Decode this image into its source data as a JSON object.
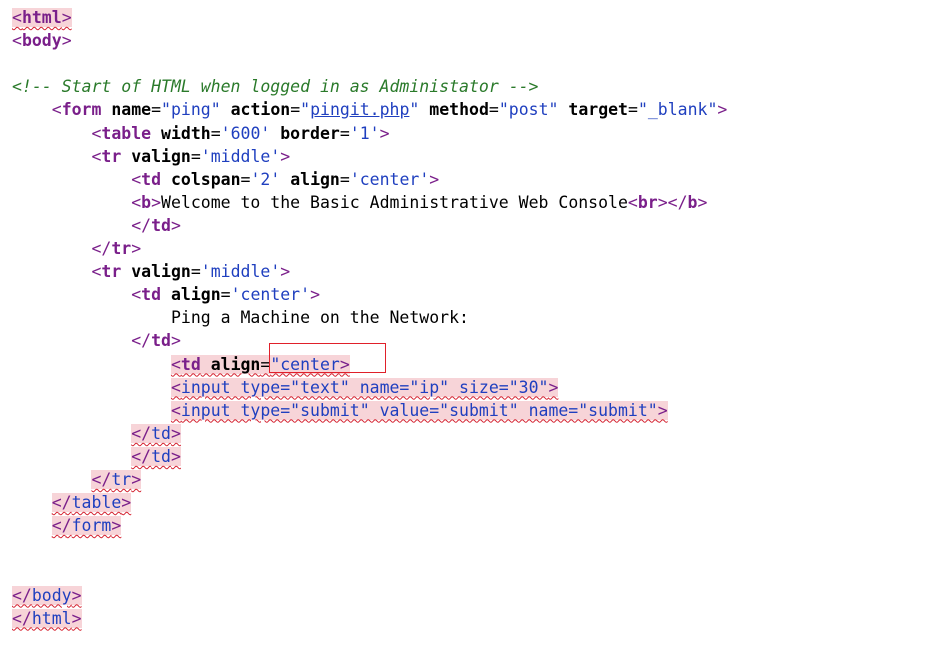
{
  "editor": {
    "lines": [
      {
        "indent": "",
        "parts": [
          {
            "cls": "br",
            "t": "<"
          },
          {
            "cls": "tg",
            "t": "html"
          },
          {
            "cls": "br",
            "t": ">"
          }
        ],
        "error": true
      },
      {
        "indent": "",
        "parts": [
          {
            "cls": "br",
            "t": "<"
          },
          {
            "cls": "tg",
            "t": "body"
          },
          {
            "cls": "br",
            "t": ">"
          }
        ],
        "error": false
      },
      {
        "indent": "",
        "parts": [],
        "error": false
      },
      {
        "indent": "",
        "parts": [
          {
            "cls": "cm",
            "t": "<!-- Start of HTML when logged in as Administator -->"
          }
        ],
        "error": false
      },
      {
        "indent": "    ",
        "parts": [
          {
            "cls": "br",
            "t": "<"
          },
          {
            "cls": "tg",
            "t": "form"
          },
          {
            "cls": "at",
            "t": " name"
          },
          {
            "cls": "tx",
            "t": "="
          },
          {
            "cls": "vl",
            "t": "\"ping\""
          },
          {
            "cls": "at",
            "t": " action"
          },
          {
            "cls": "tx",
            "t": "="
          },
          {
            "cls": "vl",
            "t": "\""
          },
          {
            "cls": "lk",
            "t": "pingit.php"
          },
          {
            "cls": "vl",
            "t": "\""
          },
          {
            "cls": "at",
            "t": " method"
          },
          {
            "cls": "tx",
            "t": "="
          },
          {
            "cls": "vl",
            "t": "\"post\""
          },
          {
            "cls": "at",
            "t": " target"
          },
          {
            "cls": "tx",
            "t": "="
          },
          {
            "cls": "vl",
            "t": "\"_blank\""
          },
          {
            "cls": "br",
            "t": ">"
          }
        ],
        "error": false
      },
      {
        "indent": "        ",
        "parts": [
          {
            "cls": "br",
            "t": "<"
          },
          {
            "cls": "tg",
            "t": "table"
          },
          {
            "cls": "at",
            "t": " width"
          },
          {
            "cls": "tx",
            "t": "="
          },
          {
            "cls": "vl",
            "t": "'600'"
          },
          {
            "cls": "at",
            "t": " border"
          },
          {
            "cls": "tx",
            "t": "="
          },
          {
            "cls": "vl",
            "t": "'1'"
          },
          {
            "cls": "br",
            "t": ">"
          }
        ],
        "error": false
      },
      {
        "indent": "        ",
        "parts": [
          {
            "cls": "br",
            "t": "<"
          },
          {
            "cls": "tg",
            "t": "tr"
          },
          {
            "cls": "at",
            "t": " valign"
          },
          {
            "cls": "tx",
            "t": "="
          },
          {
            "cls": "vl",
            "t": "'middle'"
          },
          {
            "cls": "br",
            "t": ">"
          }
        ],
        "error": false
      },
      {
        "indent": "            ",
        "parts": [
          {
            "cls": "br",
            "t": "<"
          },
          {
            "cls": "tg",
            "t": "td"
          },
          {
            "cls": "at",
            "t": " colspan"
          },
          {
            "cls": "tx",
            "t": "="
          },
          {
            "cls": "vl",
            "t": "'2'"
          },
          {
            "cls": "at",
            "t": " align"
          },
          {
            "cls": "tx",
            "t": "="
          },
          {
            "cls": "vl",
            "t": "'center'"
          },
          {
            "cls": "br",
            "t": ">"
          }
        ],
        "error": false
      },
      {
        "indent": "            ",
        "parts": [
          {
            "cls": "br",
            "t": "<"
          },
          {
            "cls": "tg",
            "t": "b"
          },
          {
            "cls": "br",
            "t": ">"
          },
          {
            "cls": "tx",
            "t": "Welcome to the Basic Administrative Web Console"
          },
          {
            "cls": "br",
            "t": "<"
          },
          {
            "cls": "tg",
            "t": "br"
          },
          {
            "cls": "br",
            "t": "></"
          },
          {
            "cls": "tg",
            "t": "b"
          },
          {
            "cls": "br",
            "t": ">"
          }
        ],
        "error": false
      },
      {
        "indent": "            ",
        "parts": [
          {
            "cls": "br",
            "t": "</"
          },
          {
            "cls": "tg",
            "t": "td"
          },
          {
            "cls": "br",
            "t": ">"
          }
        ],
        "error": false
      },
      {
        "indent": "        ",
        "parts": [
          {
            "cls": "br",
            "t": "</"
          },
          {
            "cls": "tg",
            "t": "tr"
          },
          {
            "cls": "br",
            "t": ">"
          }
        ],
        "error": false
      },
      {
        "indent": "        ",
        "parts": [
          {
            "cls": "br",
            "t": "<"
          },
          {
            "cls": "tg",
            "t": "tr"
          },
          {
            "cls": "at",
            "t": " valign"
          },
          {
            "cls": "tx",
            "t": "="
          },
          {
            "cls": "vl",
            "t": "'middle'"
          },
          {
            "cls": "br",
            "t": ">"
          }
        ],
        "error": false
      },
      {
        "indent": "            ",
        "parts": [
          {
            "cls": "br",
            "t": "<"
          },
          {
            "cls": "tg",
            "t": "td"
          },
          {
            "cls": "at",
            "t": " align"
          },
          {
            "cls": "tx",
            "t": "="
          },
          {
            "cls": "vl",
            "t": "'center'"
          },
          {
            "cls": "br",
            "t": ">"
          }
        ],
        "error": false
      },
      {
        "indent": "                ",
        "parts": [
          {
            "cls": "tx",
            "t": "Ping a Machine on the Network:"
          }
        ],
        "error": false
      },
      {
        "indent": "            ",
        "parts": [
          {
            "cls": "br",
            "t": "</"
          },
          {
            "cls": "tg",
            "t": "td"
          },
          {
            "cls": "br",
            "t": ">"
          }
        ],
        "error": false
      },
      {
        "indent": "                ",
        "parts": [
          {
            "cls": "br",
            "t": "<"
          },
          {
            "cls": "tg",
            "t": "td"
          },
          {
            "cls": "at",
            "t": " align"
          },
          {
            "cls": "tx",
            "t": "="
          },
          {
            "cls": "vl",
            "t": "\"center"
          },
          {
            "cls": "br",
            "t": ">"
          }
        ],
        "error": true
      },
      {
        "indent": "                ",
        "parts": [
          {
            "cls": "br",
            "t": "<"
          },
          {
            "cls": "vl",
            "t": "input type=\"text\" name=\"ip\" size=\"30\""
          },
          {
            "cls": "br",
            "t": ">"
          }
        ],
        "error": true
      },
      {
        "indent": "                ",
        "parts": [
          {
            "cls": "br",
            "t": "<"
          },
          {
            "cls": "vl",
            "t": "input type=\"submit\" value=\"submit\" name=\"submit\""
          },
          {
            "cls": "br",
            "t": ">"
          }
        ],
        "error": true
      },
      {
        "indent": "            ",
        "parts": [
          {
            "cls": "br",
            "t": "</"
          },
          {
            "cls": "vl",
            "t": "td"
          },
          {
            "cls": "br",
            "t": ">"
          }
        ],
        "error": true
      },
      {
        "indent": "            ",
        "parts": [
          {
            "cls": "br",
            "t": "</"
          },
          {
            "cls": "vl",
            "t": "td"
          },
          {
            "cls": "br",
            "t": ">"
          }
        ],
        "error": true
      },
      {
        "indent": "        ",
        "parts": [
          {
            "cls": "br",
            "t": "</"
          },
          {
            "cls": "vl",
            "t": "tr"
          },
          {
            "cls": "br",
            "t": ">"
          }
        ],
        "error": true
      },
      {
        "indent": "    ",
        "parts": [
          {
            "cls": "br",
            "t": "</"
          },
          {
            "cls": "vl",
            "t": "table"
          },
          {
            "cls": "br",
            "t": ">"
          }
        ],
        "error": true
      },
      {
        "indent": "    ",
        "parts": [
          {
            "cls": "br",
            "t": "</"
          },
          {
            "cls": "vl",
            "t": "form"
          },
          {
            "cls": "br",
            "t": ">"
          }
        ],
        "error": true
      },
      {
        "indent": "",
        "parts": [],
        "error": false
      },
      {
        "indent": "",
        "parts": [],
        "error": false
      },
      {
        "indent": "",
        "parts": [
          {
            "cls": "br",
            "t": "</"
          },
          {
            "cls": "vl",
            "t": "body"
          },
          {
            "cls": "br",
            "t": ">"
          }
        ],
        "error": true
      },
      {
        "indent": "",
        "parts": [
          {
            "cls": "br",
            "t": "</"
          },
          {
            "cls": "vl",
            "t": "html"
          },
          {
            "cls": "br",
            "t": ">"
          }
        ],
        "error": true
      }
    ]
  },
  "annotation": {
    "highlight_color": "#e0202a",
    "error_bg": "#f7d4d8"
  }
}
